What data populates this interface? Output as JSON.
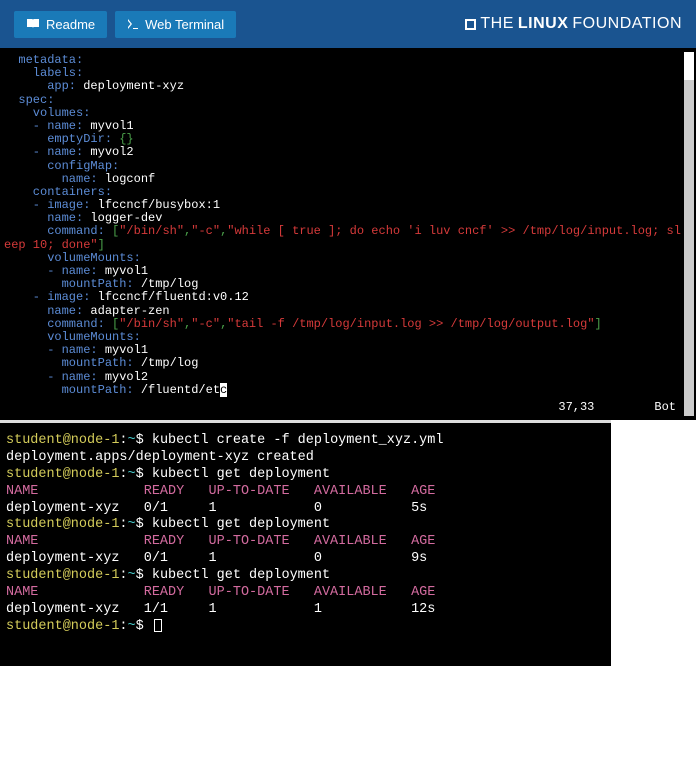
{
  "header": {
    "readme_label": "Readme",
    "terminal_label": "Web Terminal",
    "brand_linux": "LINUX",
    "brand_the": "THE",
    "brand_foundation": "FOUNDATION"
  },
  "editor": {
    "status_pos": "37,33",
    "status_mode": "Bot",
    "lines": {
      "l01_k": "  metadata:",
      "l02_k": "    labels:",
      "l03_k": "      app:",
      "l03_v": " deployment-xyz",
      "l04_k": "  spec:",
      "l05_k": "    volumes:",
      "l06_k": "    - name:",
      "l06_v": " myvol1",
      "l07_k": "      emptyDir:",
      "l07_v": " {}",
      "l08_k": "    - name:",
      "l08_v": " myvol2",
      "l09_k": "      configMap:",
      "l10_k": "        name:",
      "l10_v": " logconf",
      "l11_k": "    containers:",
      "l12_k": "    - image:",
      "l12_v": " lfccncf/busybox:1",
      "l13_k": "      name:",
      "l13_v": " logger-dev",
      "l14_k": "      command:",
      "l14_b1": " [",
      "l14_s1": "\"/bin/sh\"",
      "l14_c": ",",
      "l14_s2": "\"-c\"",
      "l14_s3": "\"while [ true ]; do echo 'i luv cncf' >> /tmp/log/input.log; sl",
      "l14b_a": "eep 10; done\"",
      "l14b_b": "]",
      "l15_k": "      volumeMounts:",
      "l16_k": "      - name:",
      "l16_v": " myvol1",
      "l17_k": "        mountPath:",
      "l17_v": " /tmp/log",
      "l18_k": "    - image:",
      "l18_v": " lfccncf/fluentd:v0.12",
      "l19_k": "      name:",
      "l19_v": " adapter-zen",
      "l20_k": "      command:",
      "l20_b1": " [",
      "l20_s1": "\"/bin/sh\"",
      "l20_s2": "\"-c\"",
      "l20_s3": "\"tail -f /tmp/log/input.log >> /tmp/log/output.log\"",
      "l20_b2": "]",
      "l21_k": "      volumeMounts:",
      "l22_k": "      - name:",
      "l22_v": " myvol1",
      "l23_k": "        mountPath:",
      "l23_v": " /tmp/log",
      "l24_k": "      - name:",
      "l24_v": " myvol2",
      "l25_k": "        mountPath:",
      "l25_v": " /fluentd/et",
      "l25_c": "c"
    }
  },
  "terminal": {
    "prompt_user": "student@node-1",
    "prompt_sep": ":",
    "prompt_path": "~",
    "prompt_end": "$ ",
    "cmd1": "kubectl create -f deployment_xyz.yml",
    "out1": "deployment.apps/deployment-xyz created",
    "cmd2": "kubectl get deployment",
    "hdr": "NAME             READY   UP-TO-DATE   AVAILABLE   AGE",
    "row_5s": "deployment-xyz   0/1     1            0           5s",
    "row_9s": "deployment-xyz   0/1     1            0           9s",
    "row_12s": "deployment-xyz   1/1     1            1           12s"
  }
}
